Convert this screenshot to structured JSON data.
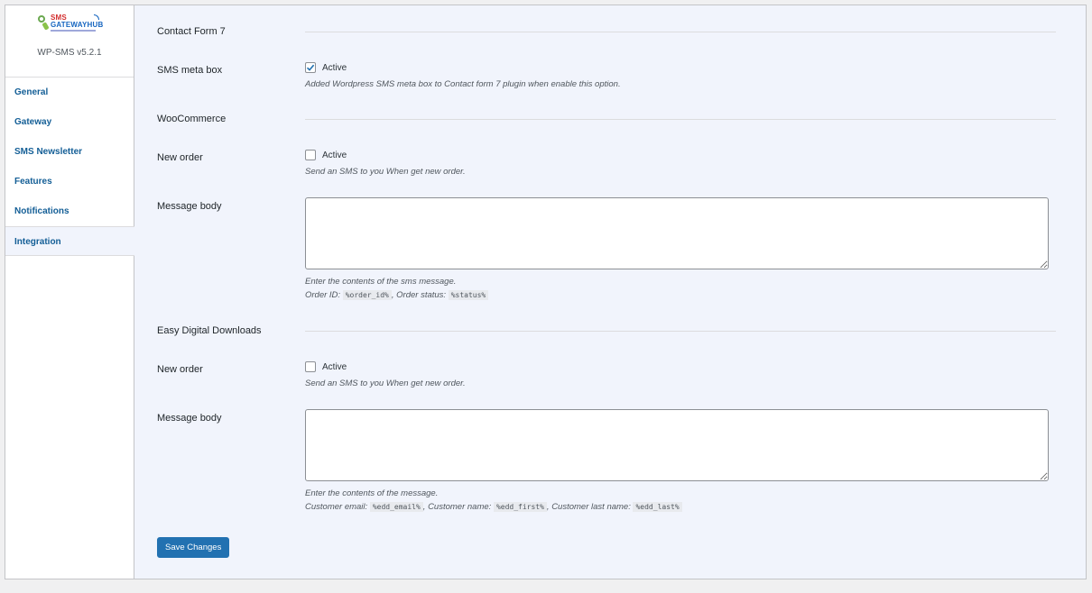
{
  "sidebar": {
    "logo": {
      "line1": "SMS",
      "line2": "GATEWAYHUB"
    },
    "version": "WP-SMS v5.2.1",
    "items": [
      {
        "label": "General"
      },
      {
        "label": "Gateway"
      },
      {
        "label": "SMS Newsletter"
      },
      {
        "label": "Features"
      },
      {
        "label": "Notifications"
      },
      {
        "label": "Integration"
      }
    ]
  },
  "cf7": {
    "title": "Contact Form 7",
    "meta_box": {
      "label": "SMS meta box",
      "checkbox_label": "Active",
      "checked": true,
      "description": "Added Wordpress SMS meta box to Contact form 7 plugin when enable this option."
    }
  },
  "woo": {
    "title": "WooCommerce",
    "new_order": {
      "label": "New order",
      "checkbox_label": "Active",
      "checked": false,
      "description": "Send an SMS to you When get new order."
    },
    "message": {
      "label": "Message body",
      "value": "",
      "description": "Enter the contents of the sms message.",
      "vars_prefix1": "Order ID:",
      "var1": "%order_id%",
      "vars_prefix2": ", Order status:",
      "var2": "%status%"
    }
  },
  "edd": {
    "title": "Easy Digital Downloads",
    "new_order": {
      "label": "New order",
      "checkbox_label": "Active",
      "checked": false,
      "description": "Send an SMS to you When get new order."
    },
    "message": {
      "label": "Message body",
      "value": "",
      "description": "Enter the contents of the message.",
      "vars_prefix1": "Customer email:",
      "var1": "%edd_email%",
      "vars_prefix2": ", Customer name:",
      "var2": "%edd_first%",
      "vars_prefix3": ", Customer last name:",
      "var3": "%edd_last%"
    }
  },
  "save_label": "Save Changes",
  "colors": {
    "accent": "#2271b1",
    "link": "#135e96",
    "content_bg": "#f1f4fc"
  }
}
